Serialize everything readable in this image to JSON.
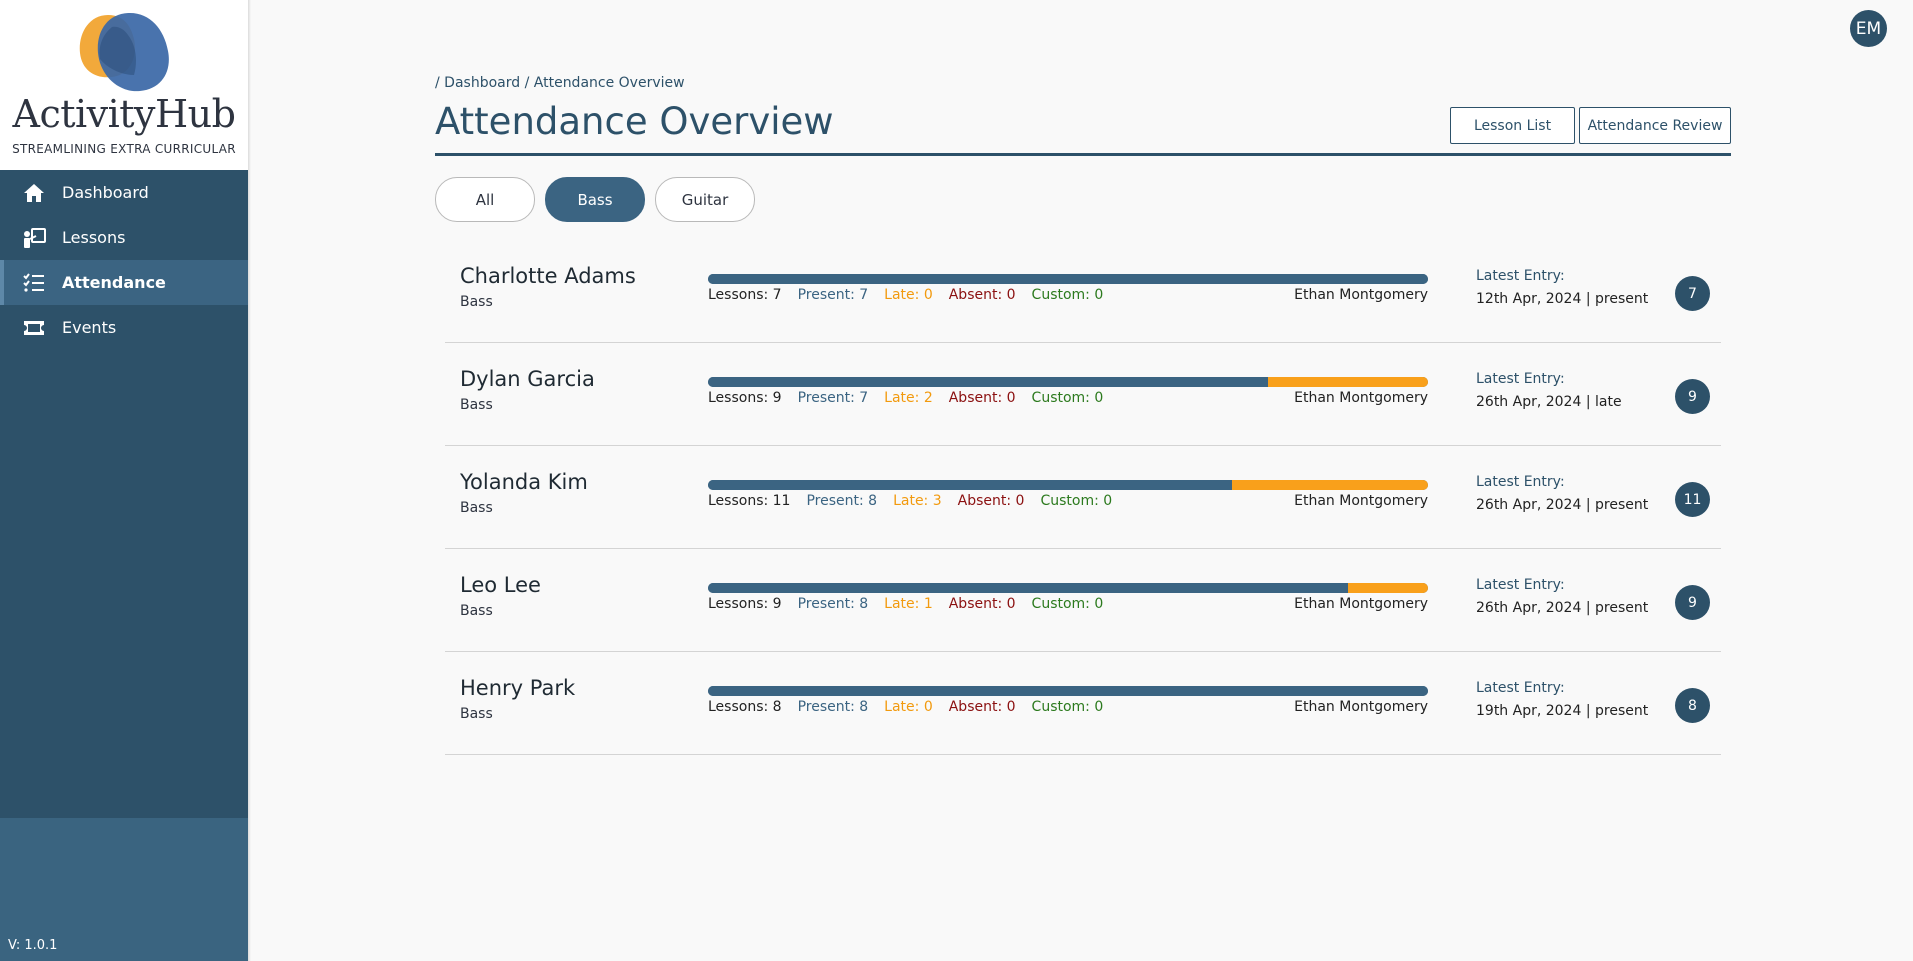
{
  "app": {
    "name": "ActivityHub",
    "tagline": "STREAMLINING EXTRA CURRICULAR",
    "version": "V: 1.0.1",
    "colors": {
      "primary": "#2d5169",
      "active_nav": "#3b6482",
      "late": "#f9a01b",
      "absent": "#8b1010",
      "custom": "#2c7a1e",
      "logo_orange": "#f2a93b",
      "logo_blue": "#3a67a6"
    }
  },
  "sidebar": {
    "items": [
      {
        "label": "Dashboard",
        "icon": "home-icon",
        "active": false
      },
      {
        "label": "Lessons",
        "icon": "teacher-board-icon",
        "active": false
      },
      {
        "label": "Attendance",
        "icon": "checklist-icon",
        "active": true
      },
      {
        "label": "Events",
        "icon": "ticket-icon",
        "active": false
      }
    ]
  },
  "user": {
    "initials": "EM"
  },
  "breadcrumb": {
    "sep": "/",
    "home": "Dashboard",
    "current": "Attendance Overview"
  },
  "page": {
    "title": "Attendance Overview"
  },
  "header_buttons": {
    "lessons": "Lesson List",
    "review": "Attendance Review"
  },
  "filters": [
    {
      "label": "All",
      "active": false
    },
    {
      "label": "Bass",
      "active": true
    },
    {
      "label": "Guitar",
      "active": false
    }
  ],
  "students": [
    {
      "name": "Charlotte Adams",
      "instrument": "Bass",
      "lessons": "Lessons: 7",
      "present": "Present: 7",
      "late": "Late: 0",
      "absent": "Absent: 0",
      "custom": "Custom: 0",
      "teacher": "Ethan Montgomery",
      "latest_label": "Latest Entry:",
      "latest": "12th Apr, 2024 | present",
      "count": "7",
      "present_n": 7,
      "late_n": 0,
      "total_n": 7
    },
    {
      "name": "Dylan Garcia",
      "instrument": "Bass",
      "lessons": "Lessons: 9",
      "present": "Present: 7",
      "late": "Late: 2",
      "absent": "Absent: 0",
      "custom": "Custom: 0",
      "teacher": "Ethan Montgomery",
      "latest_label": "Latest Entry:",
      "latest": "26th Apr, 2024 | late",
      "count": "9",
      "present_n": 7,
      "late_n": 2,
      "total_n": 9
    },
    {
      "name": "Yolanda Kim",
      "instrument": "Bass",
      "lessons": "Lessons: 11",
      "present": "Present: 8",
      "late": "Late: 3",
      "absent": "Absent: 0",
      "custom": "Custom: 0",
      "teacher": "Ethan Montgomery",
      "latest_label": "Latest Entry:",
      "latest": "26th Apr, 2024 | present",
      "count": "11",
      "present_n": 8,
      "late_n": 3,
      "total_n": 11
    },
    {
      "name": "Leo Lee",
      "instrument": "Bass",
      "lessons": "Lessons: 9",
      "present": "Present: 8",
      "late": "Late: 1",
      "absent": "Absent: 0",
      "custom": "Custom: 0",
      "teacher": "Ethan Montgomery",
      "latest_label": "Latest Entry:",
      "latest": "26th Apr, 2024 | present",
      "count": "9",
      "present_n": 8,
      "late_n": 1,
      "total_n": 9
    },
    {
      "name": "Henry Park",
      "instrument": "Bass",
      "lessons": "Lessons: 8",
      "present": "Present: 8",
      "late": "Late: 0",
      "absent": "Absent: 0",
      "custom": "Custom: 0",
      "teacher": "Ethan Montgomery",
      "latest_label": "Latest Entry:",
      "latest": "19th Apr, 2024 | present",
      "count": "8",
      "present_n": 8,
      "late_n": 0,
      "total_n": 8
    }
  ]
}
